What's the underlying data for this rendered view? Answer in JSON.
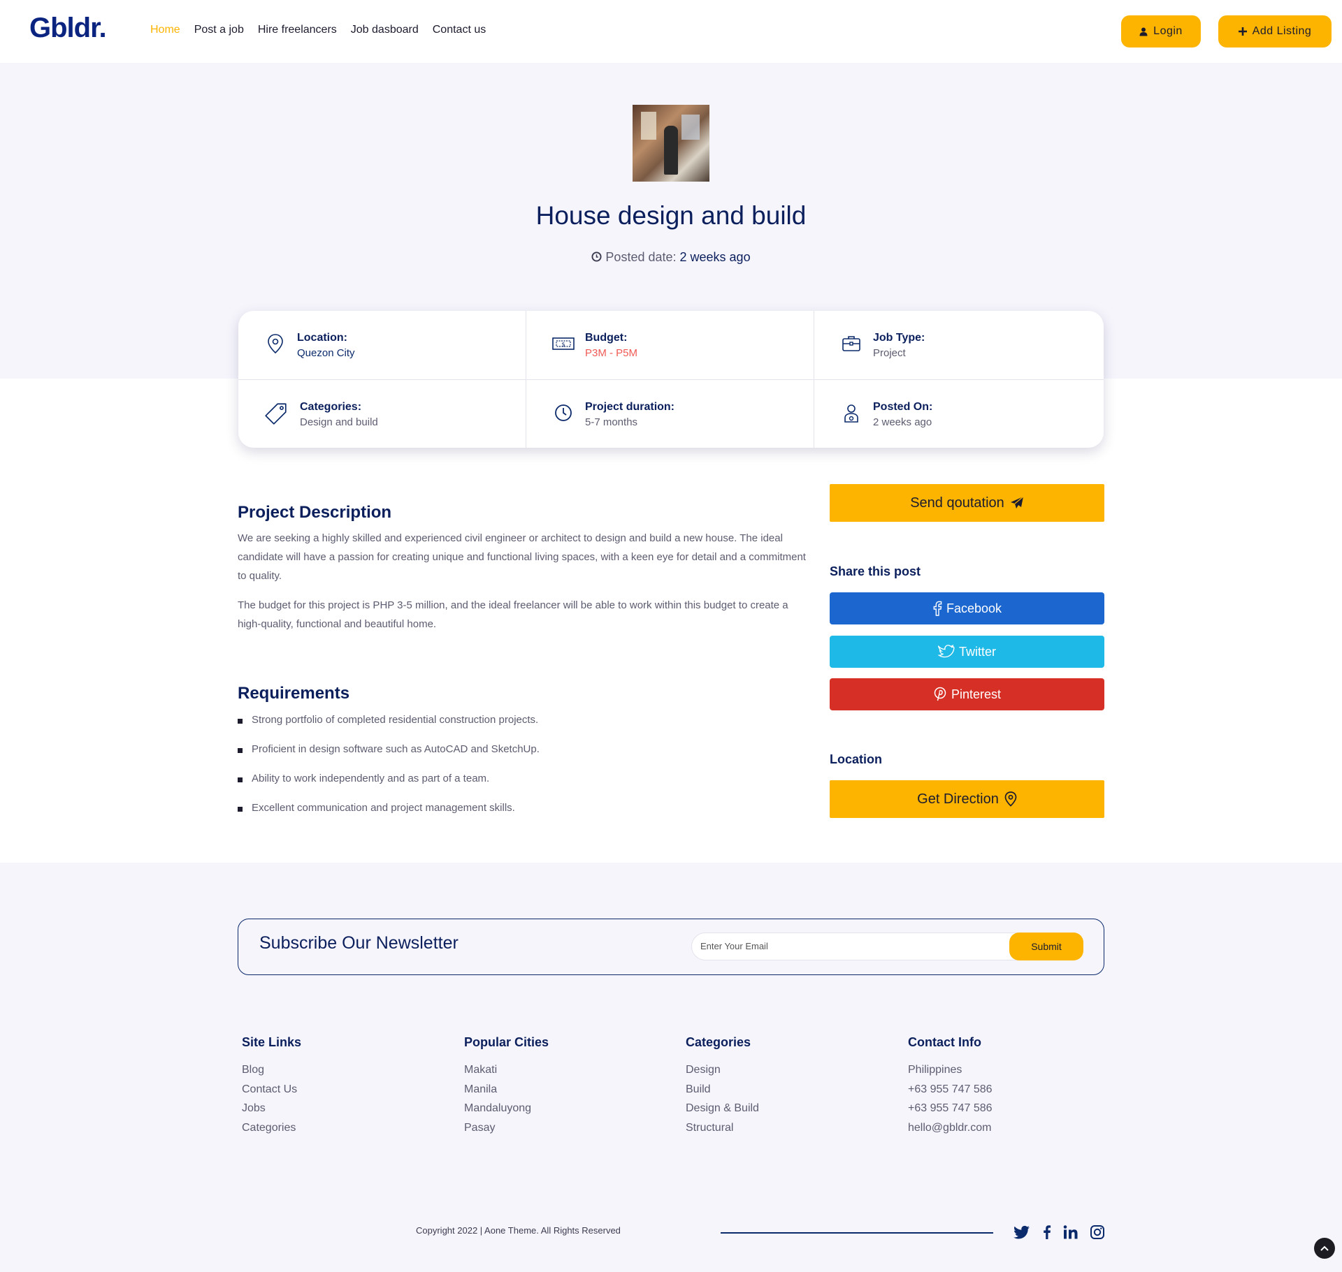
{
  "header": {
    "logo": "Gbldr.",
    "nav": [
      "Home",
      "Post a job",
      "Hire freelancers",
      "Job dasboard",
      "Contact us"
    ],
    "login_label": "Login",
    "add_listing_label": "Add Listing"
  },
  "job": {
    "title": "House design and build",
    "posted_label": "Posted date:",
    "posted_value": "2 weeks ago"
  },
  "details": {
    "location_label": "Location:",
    "location_value": "Quezon City",
    "budget_label": "Budget:",
    "budget_value": "P3M - P5M",
    "job_type_label": "Job Type:",
    "job_type_value": "Project",
    "categories_label": "Categories:",
    "categories_value": "Design and build",
    "duration_label": "Project duration:",
    "duration_value": "5-7 months",
    "posted_on_label": "Posted On:",
    "posted_on_value": "2 weeks ago"
  },
  "description": {
    "title": "Project Description",
    "p1": "We are seeking a highly skilled and experienced civil engineer or architect to design and build a new house. The ideal candidate will have a passion for creating unique and functional living spaces, with a keen eye for detail and a commitment to quality.",
    "p2": "The budget for this project is PHP 3-5 million, and the ideal freelancer will be able to work within this budget to create a high-quality, functional and beautiful home."
  },
  "requirements": {
    "title": "Requirements",
    "items": [
      "Strong portfolio of completed residential construction projects.",
      "Proficient in design software such as AutoCAD and SketchUp.",
      "Ability to work independently and as part of a team.",
      "Excellent communication and project management skills."
    ]
  },
  "sidebar": {
    "send_label": "Send qoutation",
    "share_title": "Share this post",
    "facebook_label": "Facebook",
    "twitter_label": "Twitter",
    "pinterest_label": "Pinterest",
    "location_title": "Location",
    "direction_label": "Get Direction"
  },
  "newsletter": {
    "title": "Subscribe Our Newsletter",
    "placeholder": "Enter Your Email",
    "submit_label": "Submit"
  },
  "footer": {
    "site_links": {
      "title": "Site Links",
      "items": [
        "Blog",
        "Contact Us",
        "Jobs",
        "Categories"
      ]
    },
    "popular_cities": {
      "title": "Popular Cities",
      "items": [
        "Makati",
        "Manila",
        "Mandaluyong",
        "Pasay"
      ]
    },
    "categories": {
      "title": "Categories",
      "items": [
        "Design",
        "Build",
        "Design & Build",
        "Structural"
      ]
    },
    "contact": {
      "title": "Contact Info",
      "items": [
        "Philippines",
        "+63 955 747 586",
        "+63 955 747 586",
        "hello@gbldr.com"
      ]
    },
    "copyright": "Copyright 2022 | Aone Theme. All Rights Reserved"
  },
  "colors": {
    "accent": "#fdb400",
    "navy": "#0b1f5c",
    "facebook": "#1c66d0",
    "twitter": "#1eb9e6",
    "pinterest": "#d63026",
    "hero_bg": "#f6f5fc"
  },
  "icons": [
    "user-icon",
    "plus-icon",
    "clock-icon",
    "map-pin-icon",
    "money-icon",
    "briefcase-icon",
    "tag-icon",
    "person-icon",
    "paper-plane-icon",
    "facebook-icon",
    "twitter-icon",
    "pinterest-icon",
    "linkedin-icon",
    "instagram-icon",
    "chevron-up-icon"
  ]
}
